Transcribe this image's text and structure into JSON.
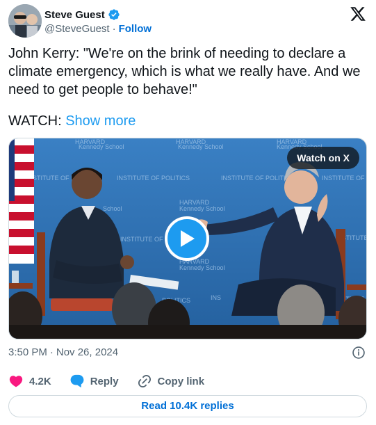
{
  "author": {
    "display_name": "Steve Guest",
    "handle": "@SteveGuest",
    "separator": "·",
    "follow_label": "Follow",
    "verified": true
  },
  "tweet": {
    "text": "John Kerry: \"We're on the brink of needing to declare a\nclimate emergency, which is what we really have. And we\nneed to get people to behave!\"",
    "watch_prefix": "WATCH: ",
    "show_more_label": "Show more"
  },
  "media": {
    "watch_on_x_label": "Watch on X",
    "backdrop_texts": [
      "HARVARD",
      "Kennedy School",
      "INSTITUTE OF POLITICS"
    ]
  },
  "meta": {
    "time": "3:50 PM",
    "separator": "·",
    "date": "Nov 26, 2024"
  },
  "actions": {
    "like_count": "4.2K",
    "reply_label": "Reply",
    "copy_link_label": "Copy link"
  },
  "read_replies_label": "Read 10.4K replies",
  "colors": {
    "accent": "#1d9bf0",
    "link": "#006fd6",
    "like": "#f91880",
    "secondary_text": "#536471",
    "backdrop_blue": "#2f6fb0"
  },
  "icons": [
    "avatar",
    "verified-badge-icon",
    "x-logo-icon",
    "play-icon",
    "info-icon",
    "heart-icon",
    "reply-bubble-icon",
    "link-icon"
  ]
}
